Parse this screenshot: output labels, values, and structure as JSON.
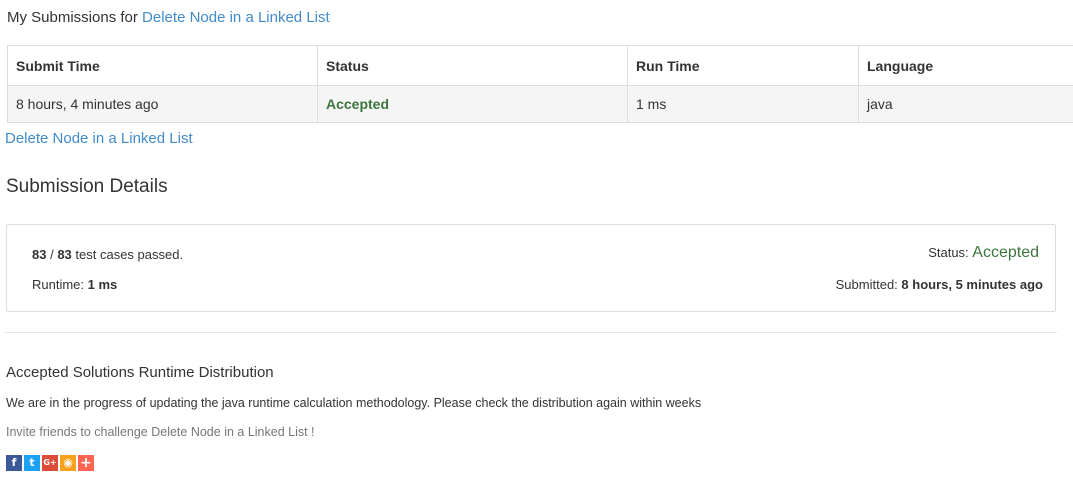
{
  "header": {
    "prefix": "My Submissions for",
    "problem_link": "Delete Node in a Linked List"
  },
  "table": {
    "headers": [
      "Submit Time",
      "Status",
      "Run Time",
      "Language"
    ],
    "rows": [
      {
        "submit_time": "8 hours, 4 minutes ago",
        "status": "Accepted",
        "run_time": "1 ms",
        "language": "java"
      }
    ]
  },
  "problem_link": "Delete Node in a Linked List",
  "details": {
    "title": "Submission Details",
    "passed": "83",
    "separator": " / ",
    "total": "83",
    "passed_suffix": " test cases passed.",
    "runtime_label": "Runtime: ",
    "runtime_value": "1 ms",
    "status_label": "Status: ",
    "status_value": "Accepted",
    "submitted_label": "Submitted: ",
    "submitted_value": "8 hours, 5 minutes ago"
  },
  "distribution": {
    "title": "Accepted Solutions Runtime Distribution",
    "message": "We are in the progress of updating the java runtime calculation methodology. Please check the distribution again within weeks",
    "invite": "Invite friends to challenge Delete Node in a Linked List !"
  },
  "share": [
    {
      "name": "facebook-icon",
      "glyph": "f",
      "color": "#3b5998"
    },
    {
      "name": "twitter-icon",
      "glyph": "t",
      "color": "#1da1f2"
    },
    {
      "name": "google-plus-icon",
      "glyph": "G+",
      "color": "#dd4b39"
    },
    {
      "name": "weibo-icon",
      "glyph": "◉",
      "color": "#f8a21c"
    },
    {
      "name": "add-share-icon",
      "glyph": "+",
      "color": "#ff6550"
    }
  ],
  "colors": {
    "link": "#428bca",
    "accepted": "#3c763d",
    "border": "#dddddd"
  }
}
